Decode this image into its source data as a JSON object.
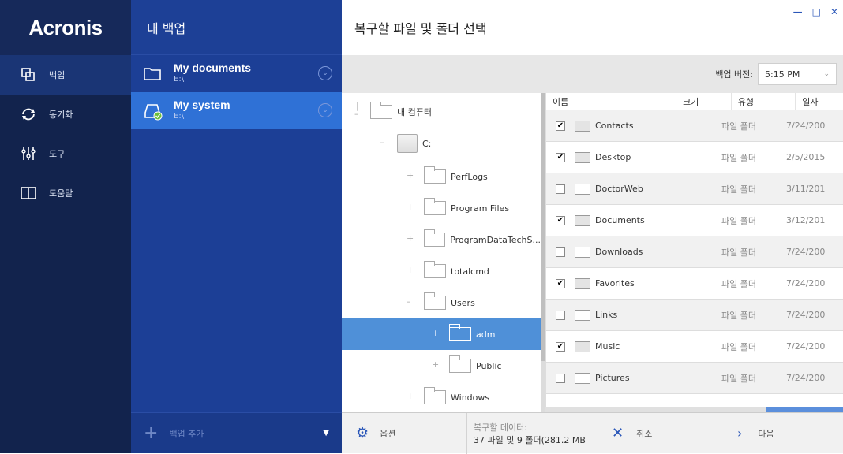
{
  "app": {
    "logo": "Acronis"
  },
  "nav": {
    "items": [
      {
        "label": "백업",
        "icon": "backup-icon",
        "active": true
      },
      {
        "label": "동기화",
        "icon": "sync-icon",
        "active": false
      },
      {
        "label": "도구",
        "icon": "tools-icon",
        "active": false
      },
      {
        "label": "도움말",
        "icon": "help-book-icon",
        "active": false
      }
    ]
  },
  "backups": {
    "title": "내 백업",
    "items": [
      {
        "name": "My documents",
        "location": "E:\\"
      },
      {
        "name": "My system",
        "location": "E:\\"
      }
    ],
    "add_label": "백업 추가"
  },
  "main": {
    "title": "복구할 파일 및 폴더 선택",
    "version_label": "백업 버전:",
    "version_value": "5:15 PM"
  },
  "tree": {
    "root": "내 컴퓨터",
    "drive": "C:",
    "folders": [
      "PerfLogs",
      "Program Files",
      "ProgramDataTechS...",
      "totalcmd",
      "Users",
      "adm",
      "Public",
      "Windows"
    ],
    "selected": "adm"
  },
  "list": {
    "headers": [
      "이름",
      "크기",
      "유형",
      "일자"
    ],
    "rows": [
      {
        "name": "Contacts",
        "checked": true,
        "type": "파일 폴더",
        "date": "7/24/200"
      },
      {
        "name": "Desktop",
        "checked": true,
        "type": "파일 폴더",
        "date": "2/5/2015"
      },
      {
        "name": "DoctorWeb",
        "checked": false,
        "type": "파일 폴더",
        "date": "3/11/201"
      },
      {
        "name": "Documents",
        "checked": true,
        "type": "파일 폴더",
        "date": "3/12/201"
      },
      {
        "name": "Downloads",
        "checked": false,
        "type": "파일 폴더",
        "date": "7/24/200"
      },
      {
        "name": "Favorites",
        "checked": true,
        "type": "파일 폴더",
        "date": "7/24/200"
      },
      {
        "name": "Links",
        "checked": false,
        "type": "파일 폴더",
        "date": "7/24/200"
      },
      {
        "name": "Music",
        "checked": true,
        "type": "파일 폴더",
        "date": "7/24/200"
      },
      {
        "name": "Pictures",
        "checked": false,
        "type": "파일 폴더",
        "date": "7/24/200"
      }
    ]
  },
  "bottom": {
    "options": "옵션",
    "recovery_label": "복구할 데이터:",
    "recovery_value": "37 파일 및 9 폴더(281.2 MB",
    "cancel": "취소",
    "next": "다음"
  },
  "colors": {
    "nav_bg": "#12234d",
    "panel_bg": "#1c3f96",
    "selected_blue": "#2f71d6",
    "tree_selected": "#4f90d8"
  }
}
